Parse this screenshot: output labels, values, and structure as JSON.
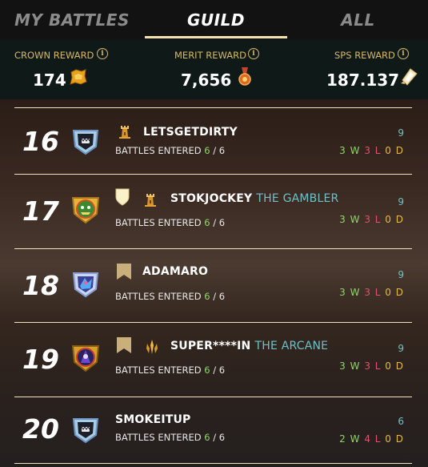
{
  "tabs": [
    {
      "label": "MY BATTLES"
    },
    {
      "label": "GUILD"
    },
    {
      "label": "ALL"
    }
  ],
  "rewards": {
    "crown": {
      "label": "CROWN REWARD",
      "value": "174",
      "icon": "crown-token-icon"
    },
    "merit": {
      "label": "MERIT REWARD",
      "value": "7,656",
      "icon": "merit-medal-icon"
    },
    "sps": {
      "label": "SPS REWARD",
      "value": "187.137",
      "icon": "sps-crystal-icon"
    }
  },
  "entered_label": "BATTLES ENTERED",
  "rows": [
    {
      "rank": "16",
      "name": "LETSGETDIRTY",
      "title": "",
      "entered": "6",
      "total": "/ 6",
      "score": "9",
      "w": "3 W",
      "l": "3 L",
      "d": "0 D"
    },
    {
      "rank": "17",
      "name": "STOKJOCKEY",
      "title": "THE GAMBLER",
      "entered": "6",
      "total": "/ 6",
      "score": "9",
      "w": "3 W",
      "l": "3 L",
      "d": "0 D"
    },
    {
      "rank": "18",
      "name": "ADAMARO",
      "title": "",
      "entered": "6",
      "total": "/ 6",
      "score": "9",
      "w": "3 W",
      "l": "3 L",
      "d": "0 D"
    },
    {
      "rank": "19",
      "name": "SUPER****IN",
      "title": "THE ARCANE",
      "entered": "6",
      "total": "/ 6",
      "score": "9",
      "w": "3 W",
      "l": "3 L",
      "d": "0 D"
    },
    {
      "rank": "20",
      "name": "SMOKEITUP",
      "title": "",
      "entered": "6",
      "total": "/ 6",
      "score": "6",
      "w": "2 W",
      "l": "4 L",
      "d": "0 D"
    }
  ],
  "colors": {
    "accent": "#f2e2b0",
    "gold": "#d7b86a",
    "green": "#8fd66a",
    "red": "#e0536a",
    "yellow": "#e6b84a",
    "teal": "#6ec1c8"
  }
}
